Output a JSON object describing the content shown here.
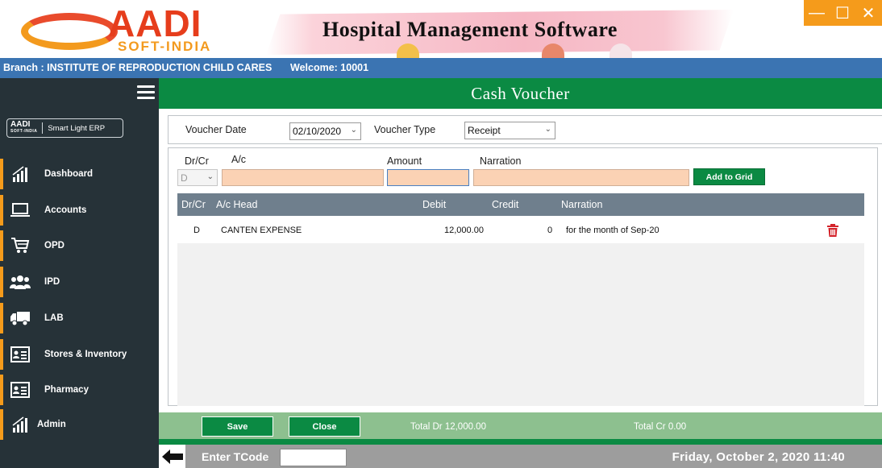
{
  "header": {
    "logo_brand": "AADI",
    "logo_sub": "SOFT-INDIA",
    "banner_title": "Hospital Management Software"
  },
  "window_controls": {
    "minimize": "—",
    "maximize": "☐",
    "close": "✕"
  },
  "branch_bar": {
    "branch": "Branch : INSTITUTE OF REPRODUCTION  CHILD CARES",
    "welcome": "Welcome: 10001"
  },
  "sidebar": {
    "erp_badge": {
      "mini_brand": "AADI",
      "mini_sub": "SOFT-INDIA",
      "label": "Smart Light ERP"
    },
    "items": [
      {
        "label": "Dashboard",
        "icon": "bar-chart-icon"
      },
      {
        "label": "Accounts",
        "icon": "laptop-icon"
      },
      {
        "label": "OPD",
        "icon": "cart-icon"
      },
      {
        "label": "IPD",
        "icon": "users-icon"
      },
      {
        "label": "LAB",
        "icon": "truck-icon"
      },
      {
        "label": "Stores & Inventory",
        "icon": "id-card-icon"
      },
      {
        "label": "Pharmacy",
        "icon": "id-card-icon"
      },
      {
        "label": "Admin",
        "icon": "bar-chart-icon"
      }
    ]
  },
  "page": {
    "title": "Cash Voucher"
  },
  "form": {
    "voucher_date_label": "Voucher Date",
    "voucher_date_value": "02/10/2020",
    "voucher_type_label": "Voucher Type",
    "voucher_type_value": "Receipt"
  },
  "entry": {
    "drcr_label": "Dr/Cr",
    "ac_label": "A/c",
    "amount_label": "Amount",
    "narration_label": "Narration",
    "drcr_value": "D",
    "add_button": "Add to Grid"
  },
  "grid": {
    "columns": [
      "Dr/Cr",
      "A/c Head",
      "Debit",
      "Credit",
      "Narration"
    ],
    "rows": [
      {
        "drcr": "D",
        "head": "CANTEN EXPENSE",
        "debit": "12,000.00",
        "credit": "0",
        "narration": "for the month of Sep-20"
      }
    ]
  },
  "actions": {
    "save": "Save",
    "close": "Close",
    "total_dr": "Total Dr 12,000.00",
    "total_cr": "Total Cr 0.00"
  },
  "status": {
    "tcode_label": "Enter TCode",
    "datetime": "Friday, October 2, 2020   11:40"
  },
  "colors": {
    "accent_orange": "#f59b1b",
    "brand_green": "#0b8a43",
    "sidebar_bg": "#263238",
    "branch_blue": "#3b74b2",
    "delete_red": "#d4232b"
  }
}
